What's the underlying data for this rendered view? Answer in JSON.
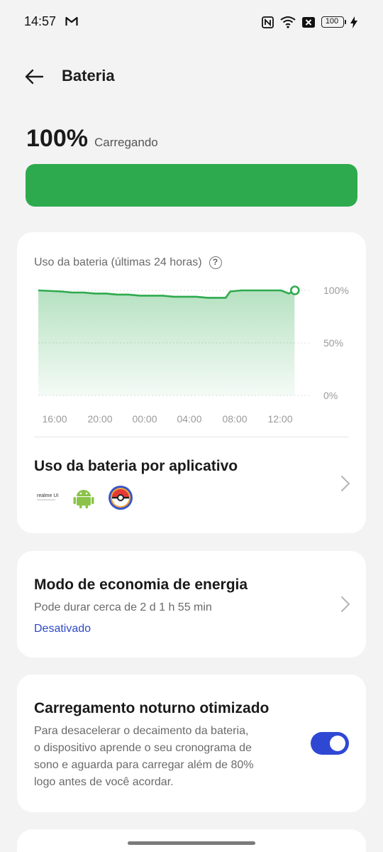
{
  "status_bar": {
    "time": "14:57",
    "battery_level": "100",
    "icons": [
      "gmail-icon",
      "nfc-icon",
      "wifi-icon",
      "no-sim-icon",
      "battery-icon",
      "charging-bolt-icon"
    ]
  },
  "header": {
    "title": "Bateria",
    "back_icon": "arrow-left-icon"
  },
  "battery": {
    "level_text": "100%",
    "status": "Carregando",
    "level_fraction": 1.0,
    "color": "#2eaa4e"
  },
  "usage_card": {
    "title": "Uso da bateria (últimas 24 horas)",
    "help_glyph": "?",
    "app_usage_title": "Uso da bateria por aplicativo",
    "apps": [
      {
        "name": "realme UI",
        "icon": "realme-icon"
      },
      {
        "name": "Android",
        "icon": "android-icon"
      },
      {
        "name": "Pokémon",
        "icon": "pokeball-icon"
      }
    ],
    "realme_label": "realme UI"
  },
  "chart_data": {
    "type": "area",
    "x_tick_labels": [
      "16:00",
      "20:00",
      "00:00",
      "04:00",
      "08:00",
      "12:00"
    ],
    "y_tick_labels": [
      "100%",
      "50%",
      "0%"
    ],
    "ylim": [
      0,
      100
    ],
    "x_hours": [
      0,
      2,
      3,
      4,
      5,
      6,
      7,
      8,
      9,
      10,
      11,
      12,
      13,
      14,
      15,
      16,
      16.6,
      17,
      18,
      19,
      20,
      21,
      21.5,
      22.2,
      22.7
    ],
    "values": [
      100,
      99,
      98,
      98,
      97,
      97,
      96,
      96,
      95,
      95,
      95,
      94,
      94,
      94,
      93,
      93,
      93,
      99,
      100,
      100,
      100,
      100,
      100,
      97,
      100
    ],
    "x_start": "14:00",
    "x_span_hours": 24,
    "color": "#2eaa4e",
    "grid": true,
    "last_point_marker": true
  },
  "saver_card": {
    "title": "Modo de economia de energia",
    "subtitle": "Pode durar cerca de 2 d 1 h 55 min",
    "status": "Desativado",
    "status_color": "#2f48c7"
  },
  "night_card": {
    "title": "Carregamento noturno otimizado",
    "description_lines": [
      "Para desacelerar o decaimento da bateria,",
      "o dispositivo aprende o seu cronograma de",
      "sono e aguarda para carregar além de 80%",
      "logo antes de você acordar."
    ],
    "toggle_on": true,
    "toggle_color": "#2f48d4"
  }
}
